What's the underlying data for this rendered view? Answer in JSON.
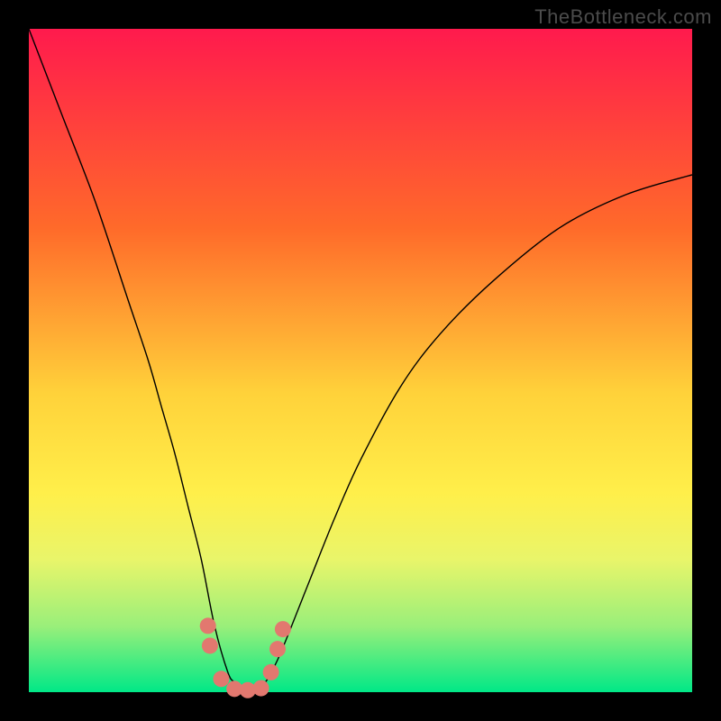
{
  "watermark": "TheBottleneck.com",
  "chart_data": {
    "type": "line",
    "title": "",
    "xlabel": "",
    "ylabel": "",
    "xlim": [
      0,
      100
    ],
    "ylim": [
      0,
      100
    ],
    "background_gradient": {
      "direction": "vertical",
      "stops": [
        {
          "position": 0,
          "color": "#ff1a4d"
        },
        {
          "position": 30,
          "color": "#ff6a2a"
        },
        {
          "position": 55,
          "color": "#ffd23a"
        },
        {
          "position": 70,
          "color": "#ffef4a"
        },
        {
          "position": 80,
          "color": "#e9f56a"
        },
        {
          "position": 90,
          "color": "#9aef7a"
        },
        {
          "position": 100,
          "color": "#00e887"
        }
      ]
    },
    "series": [
      {
        "name": "bottleneck-curve",
        "color": "#000000",
        "width": 1.4,
        "x": [
          0,
          5,
          10,
          15,
          18,
          20,
          22,
          24,
          26,
          28,
          30,
          31,
          32,
          33,
          34,
          35,
          36,
          38,
          42,
          46,
          50,
          56,
          62,
          70,
          80,
          90,
          100
        ],
        "y": [
          100,
          87,
          74,
          59,
          50,
          43,
          36,
          28,
          20,
          10,
          3,
          1.5,
          0.8,
          0.5,
          0.6,
          1.0,
          2,
          6,
          16,
          26,
          35,
          46,
          54,
          62,
          70,
          75,
          78
        ]
      }
    ],
    "markers": {
      "name": "valley-dots",
      "color": "#e2786f",
      "radius": 9,
      "points": [
        {
          "x": 27,
          "y": 10
        },
        {
          "x": 27.3,
          "y": 7
        },
        {
          "x": 29,
          "y": 2
        },
        {
          "x": 31,
          "y": 0.5
        },
        {
          "x": 33,
          "y": 0.3
        },
        {
          "x": 35,
          "y": 0.6
        },
        {
          "x": 36.5,
          "y": 3
        },
        {
          "x": 37.5,
          "y": 6.5
        },
        {
          "x": 38.3,
          "y": 9.5
        }
      ]
    }
  }
}
